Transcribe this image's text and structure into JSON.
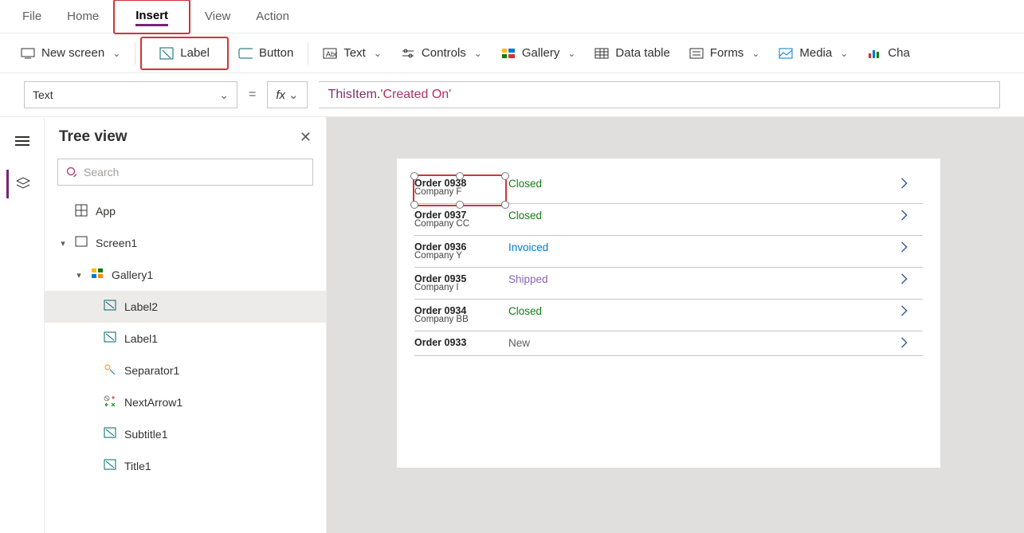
{
  "menubar": {
    "file": "File",
    "home": "Home",
    "insert": "Insert",
    "view": "View",
    "action": "Action"
  },
  "ribbon": {
    "new_screen": "New screen",
    "label": "Label",
    "button": "Button",
    "text": "Text",
    "controls": "Controls",
    "gallery": "Gallery",
    "data_table": "Data table",
    "forms": "Forms",
    "media": "Media",
    "charts": "Cha"
  },
  "formulabar": {
    "property": "Text",
    "fx": "fx",
    "formula_obj": "ThisItem",
    "formula_dot": ".",
    "formula_prop": "'Created On'"
  },
  "tree": {
    "title": "Tree view",
    "search_placeholder": "Search",
    "nodes": {
      "app": "App",
      "screen1": "Screen1",
      "gallery1": "Gallery1",
      "label2": "Label2",
      "label1": "Label1",
      "separator1": "Separator1",
      "nextarrow1": "NextArrow1",
      "subtitle1": "Subtitle1",
      "title1": "Title1"
    }
  },
  "gallery": {
    "rows": [
      {
        "title": "Order 0938",
        "sub": "Company F",
        "status": "Closed"
      },
      {
        "title": "Order 0937",
        "sub": "Company CC",
        "status": "Closed"
      },
      {
        "title": "Order 0936",
        "sub": "Company Y",
        "status": "Invoiced"
      },
      {
        "title": "Order 0935",
        "sub": "Company I",
        "status": "Shipped"
      },
      {
        "title": "Order 0934",
        "sub": "Company BB",
        "status": "Closed"
      },
      {
        "title": "Order 0933",
        "sub": "",
        "status": "New"
      }
    ]
  }
}
